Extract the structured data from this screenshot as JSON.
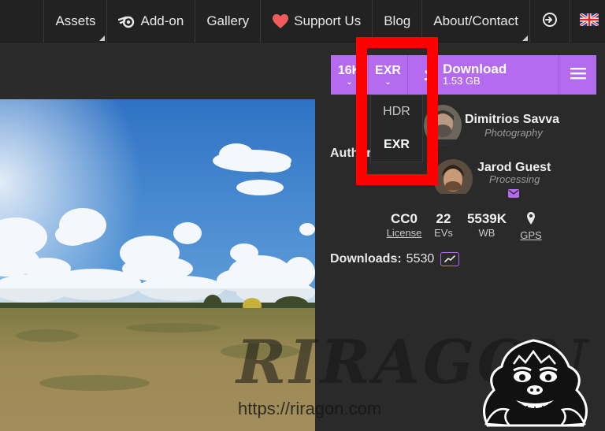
{
  "nav": {
    "items": [
      {
        "label": "Assets",
        "corner": true
      },
      {
        "label": "Add-on",
        "icon": "blender-icon",
        "corner": false
      },
      {
        "label": "Gallery",
        "corner": false
      },
      {
        "label": "Support Us",
        "icon": "heart-icon",
        "corner": false
      },
      {
        "label": "Blog",
        "corner": false
      },
      {
        "label": "About/Contact",
        "corner": true
      }
    ],
    "login_icon": "login-icon",
    "language_icon": "uk-flag-icon"
  },
  "toolbar": {
    "resolution": "16K",
    "format": "EXR",
    "download_label": "Download",
    "download_size": "1.53 GB",
    "accent_color": "#b56bf0"
  },
  "format_dropdown": {
    "options": [
      "HDR",
      "EXR"
    ],
    "selected": "EXR"
  },
  "authors": {
    "label": "Authors",
    "people": [
      {
        "name": "Dimitrios Savva",
        "role": "Photography"
      },
      {
        "name": "Jarod Guest",
        "role": "Processing"
      }
    ]
  },
  "stats": {
    "license": {
      "value": "CC0",
      "label": "License"
    },
    "evs": {
      "value": "22",
      "label": "EVs"
    },
    "wb": {
      "value": "5539K",
      "label": "WB"
    },
    "gps": {
      "label": "GPS"
    }
  },
  "downloads": {
    "label": "Downloads:",
    "count": "5530"
  },
  "watermark": {
    "text": "RIRAGON",
    "url": "https://riragon.com"
  }
}
